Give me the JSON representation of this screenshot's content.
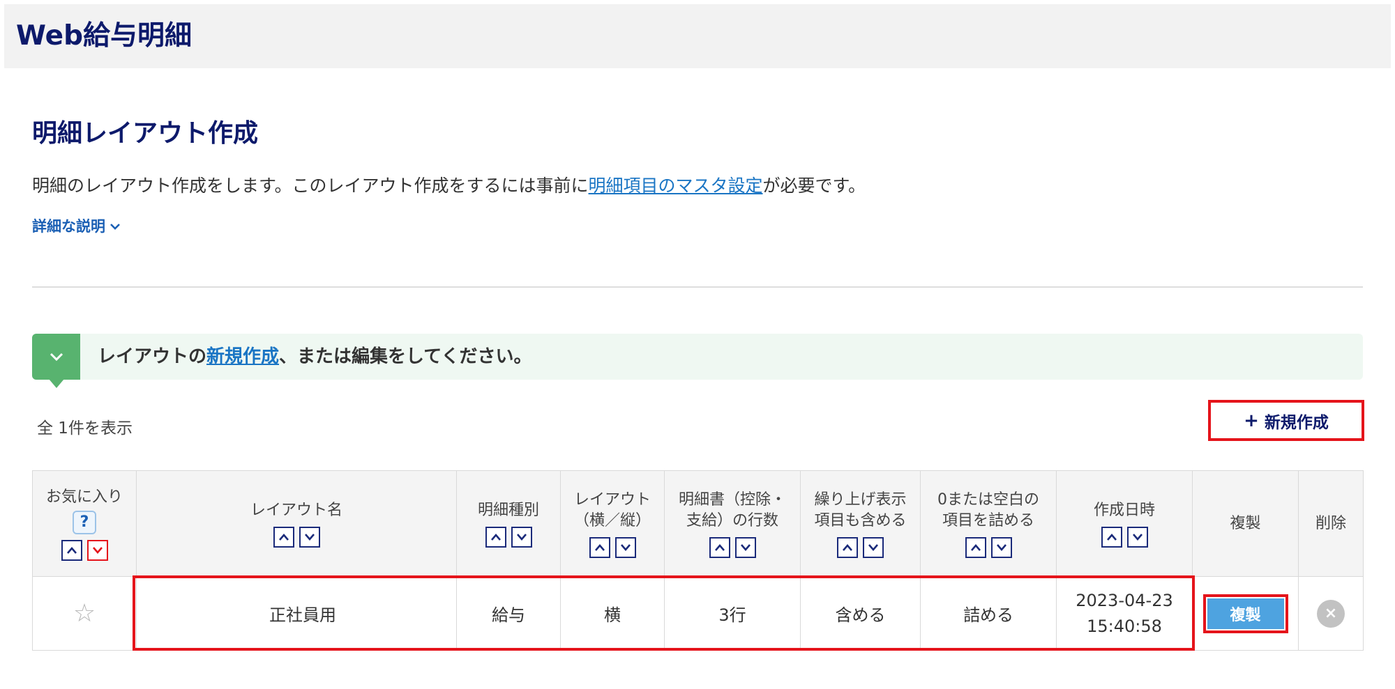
{
  "app": {
    "title": "Web給与明細"
  },
  "page": {
    "title": "明細レイアウト作成",
    "intro_before": "明細のレイアウト作成をします。このレイアウト作成をするには事前に",
    "intro_link": "明細項目のマスタ設定",
    "intro_after": "が必要です。",
    "detail_link": "詳細な説明"
  },
  "step": {
    "text_before": "レイアウトの",
    "link": "新規作成",
    "text_after": "、または編集をしてください。"
  },
  "list": {
    "count_text": "全 1件を表示",
    "new_button": "新規作成"
  },
  "table": {
    "headers": {
      "favorite": "お気に入り",
      "help": "?",
      "name": "レイアウト名",
      "type": "明細種別",
      "layout_1": "レイアウト",
      "layout_2": "（横／縦）",
      "rows_1": "明細書（控除・",
      "rows_2": "支給）の行数",
      "carry_1": "繰り上げ表示",
      "carry_2": "項目も含める",
      "zero_1": "0または空白の",
      "zero_2": "項目を詰める",
      "created": "作成日時",
      "duplicate": "複製",
      "delete": "削除"
    },
    "rows": [
      {
        "name": "正社員用",
        "type": "給与",
        "layout": "横",
        "rows": "3行",
        "carry": "含める",
        "zero": "詰める",
        "created_date": "2023-04-23",
        "created_time": "15:40:58",
        "duplicate_label": "複製"
      }
    ]
  },
  "colors": {
    "brand_navy": "#0d1a6b",
    "link_blue": "#1a75c4",
    "step_green": "#58b36f",
    "highlight_red": "#e5141b",
    "duplicate_blue": "#4ea3e0"
  }
}
